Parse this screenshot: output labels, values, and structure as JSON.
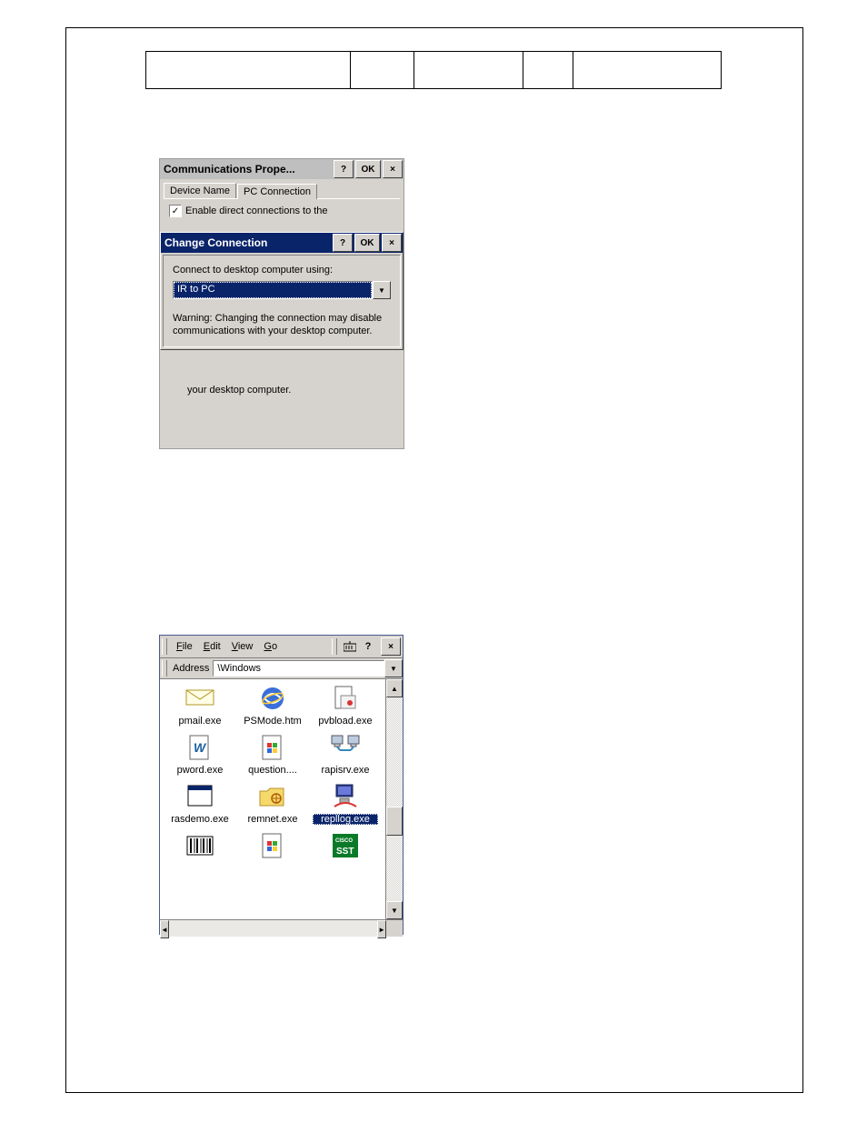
{
  "shot1": {
    "commTitle": "Communications Prope...",
    "help": "?",
    "ok": "OK",
    "close": "×",
    "tab1": "Device Name",
    "tab2": "PC Connection",
    "checkboxLabel": "Enable direct connections to the",
    "checkMark": "✓",
    "changeTitle": "Change Connection",
    "connectLabel": "Connect to desktop computer using:",
    "dropdownValue": "IR to PC",
    "dropdownArrow": "▼",
    "warning": "Warning: Changing the connection may disable communications with your desktop computer.",
    "trailing": "your desktop computer."
  },
  "shot2": {
    "menu": {
      "file": "File",
      "edit": "Edit",
      "view": "View",
      "go": "Go"
    },
    "help": "?",
    "close": "×",
    "addressLabel": "Address",
    "addressValue": "\\Windows",
    "addressArrow": "▼",
    "scroll": {
      "up": "▲",
      "down": "▼",
      "left": "◄",
      "right": "►"
    },
    "files": [
      [
        "pmail.exe",
        "PSMode.htm",
        "pvbload.exe"
      ],
      [
        "pword.exe",
        "question....",
        "rapisrv.exe"
      ],
      [
        "rasdemo.exe",
        "remnet.exe",
        "repllog.exe"
      ],
      [
        "",
        "",
        ""
      ]
    ],
    "selectedFile": "repllog.exe",
    "ciscoLabel": "CISCO",
    "sstLabel": "SST"
  }
}
